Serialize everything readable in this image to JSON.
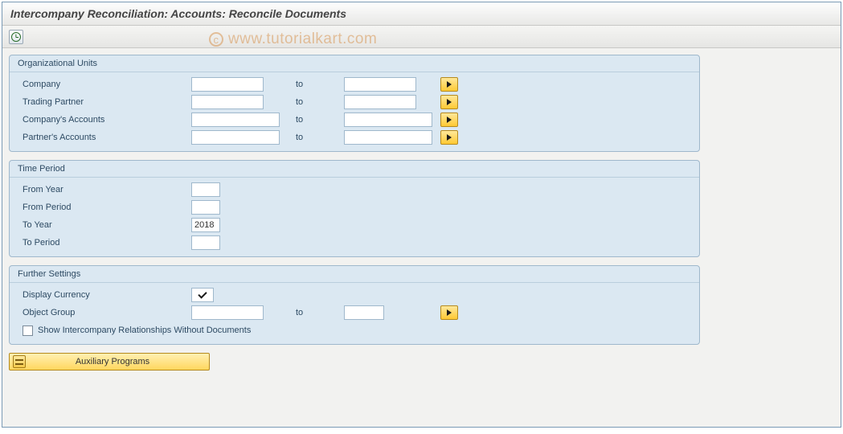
{
  "title": "Intercompany Reconciliation: Accounts: Reconcile Documents",
  "watermark": "www.tutorialkart.com",
  "groups": {
    "org": {
      "title": "Organizational Units",
      "rows": {
        "company": {
          "label": "Company",
          "from": "",
          "to_label": "to",
          "to": ""
        },
        "trading_partner": {
          "label": "Trading Partner",
          "from": "",
          "to_label": "to",
          "to": ""
        },
        "company_accounts": {
          "label": "Company's Accounts",
          "from": "",
          "to_label": "to",
          "to": ""
        },
        "partner_accounts": {
          "label": "Partner's Accounts",
          "from": "",
          "to_label": "to",
          "to": ""
        }
      }
    },
    "time": {
      "title": "Time Period",
      "rows": {
        "from_year": {
          "label": "From Year",
          "value": ""
        },
        "from_period": {
          "label": "From Period",
          "value": ""
        },
        "to_year": {
          "label": "To Year",
          "value": "2018"
        },
        "to_period": {
          "label": "To Period",
          "value": ""
        }
      }
    },
    "further": {
      "title": "Further Settings",
      "display_currency_label": "Display Currency",
      "display_currency_checked": true,
      "object_group": {
        "label": "Object Group",
        "from": "",
        "to_label": "to",
        "to": ""
      },
      "show_relationships_label": "Show Intercompany Relationships Without Documents",
      "show_relationships_checked": false
    }
  },
  "aux_button": "Auxiliary Programs"
}
